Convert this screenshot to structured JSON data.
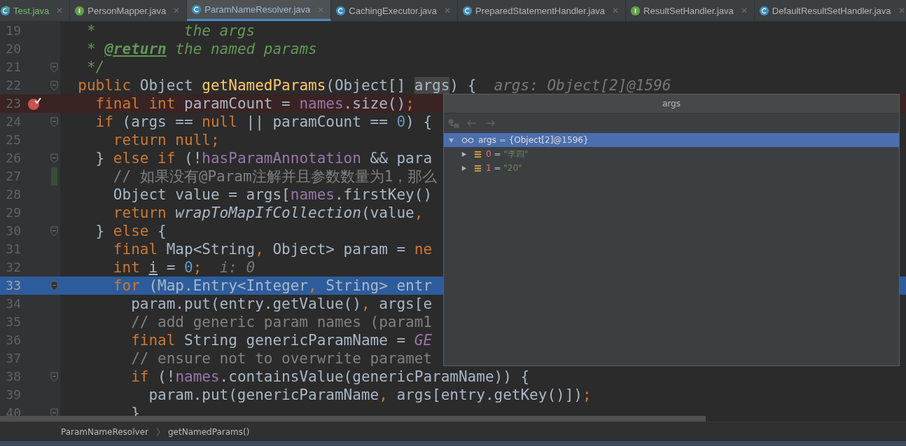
{
  "tabs": [
    {
      "label": "Test.java",
      "kind": "test",
      "selected": false
    },
    {
      "label": "PersonMapper.java",
      "kind": "interface",
      "selected": false
    },
    {
      "label": "ParamNameResolver.java",
      "kind": "class",
      "selected": true
    },
    {
      "label": "CachingExecutor.java",
      "kind": "class",
      "selected": false
    },
    {
      "label": "PreparedStatementHandler.java",
      "kind": "class",
      "selected": false
    },
    {
      "label": "ResultSetHandler.java",
      "kind": "interface",
      "selected": false
    },
    {
      "label": "DefaultResultSetHandler.java",
      "kind": "class",
      "selected": false
    }
  ],
  "editor": {
    "lines": [
      {
        "number": "19",
        "kind": "plain",
        "tokens": [
          {
            "kind": "doc",
            "t": "   *          the args"
          }
        ]
      },
      {
        "number": "20",
        "kind": "plain",
        "tokens": [
          {
            "kind": "doc",
            "t": "   * "
          },
          {
            "kind": "doctag",
            "t": "@return"
          },
          {
            "kind": "doc",
            "t": " the named params"
          }
        ]
      },
      {
        "number": "21",
        "kind": "fold",
        "tokens": [
          {
            "kind": "doc",
            "t": "   */"
          }
        ]
      },
      {
        "number": "22",
        "kind": "fold",
        "tokens": [
          {
            "kind": "kw",
            "t": "  public"
          },
          {
            "kind": "plain",
            "t": " Object "
          },
          {
            "kind": "decl",
            "t": "getNamedParams"
          },
          {
            "kind": "plain",
            "t": "(Object[] "
          },
          {
            "kind": "hl",
            "t": "args"
          },
          {
            "kind": "plain",
            "t": ") {"
          },
          {
            "kind": "hint",
            "t": "  args: Object[2]@1596"
          }
        ]
      },
      {
        "number": "23",
        "kind": "breakpoint",
        "tokens": [
          {
            "kind": "kw",
            "t": "    final int"
          },
          {
            "kind": "plain",
            "t": " paramCount = "
          },
          {
            "kind": "field",
            "t": "names"
          },
          {
            "kind": "plain",
            "t": ".size()"
          },
          {
            "kind": "kw",
            "t": ";"
          }
        ]
      },
      {
        "number": "24",
        "kind": "fold",
        "tokens": [
          {
            "kind": "kw",
            "t": "    if"
          },
          {
            "kind": "plain",
            "t": " (args == "
          },
          {
            "kind": "kw",
            "t": "null"
          },
          {
            "kind": "plain",
            "t": " || paramCount == "
          },
          {
            "kind": "num",
            "t": "0"
          },
          {
            "kind": "plain",
            "t": ") {"
          }
        ]
      },
      {
        "number": "25",
        "kind": "plain",
        "tokens": [
          {
            "kind": "kw",
            "t": "      return null;"
          }
        ]
      },
      {
        "number": "26",
        "kind": "fold",
        "tokens": [
          {
            "kind": "plain",
            "t": "    } "
          },
          {
            "kind": "kw",
            "t": "else if"
          },
          {
            "kind": "plain",
            "t": " (!"
          },
          {
            "kind": "field",
            "t": "hasParamAnnotation"
          },
          {
            "kind": "plain",
            "t": " && para"
          }
        ]
      },
      {
        "number": "27",
        "kind": "changed",
        "tokens": [
          {
            "kind": "comment",
            "t": "      // 如果没有@Param注解并且参数数量为1，那么"
          }
        ]
      },
      {
        "number": "28",
        "kind": "plain",
        "tokens": [
          {
            "kind": "plain",
            "t": "      Object value = args["
          },
          {
            "kind": "field",
            "t": "names"
          },
          {
            "kind": "plain",
            "t": ".firstKey()"
          }
        ]
      },
      {
        "number": "29",
        "kind": "plain",
        "tokens": [
          {
            "kind": "kw",
            "t": "      return"
          },
          {
            "kind": "ital",
            "t": " wrapToMapIfCollection"
          },
          {
            "kind": "plain",
            "t": "(value"
          },
          {
            "kind": "kw",
            "t": ","
          }
        ]
      },
      {
        "number": "30",
        "kind": "fold",
        "tokens": [
          {
            "kind": "plain",
            "t": "    } "
          },
          {
            "kind": "kw",
            "t": "else"
          },
          {
            "kind": "plain",
            "t": " {"
          }
        ]
      },
      {
        "number": "31",
        "kind": "plain",
        "tokens": [
          {
            "kind": "kw",
            "t": "      final"
          },
          {
            "kind": "plain",
            "t": " Map<String"
          },
          {
            "kind": "kw",
            "t": ","
          },
          {
            "kind": "plain",
            "t": " Object> param = "
          },
          {
            "kind": "kw",
            "t": "ne"
          }
        ]
      },
      {
        "number": "32",
        "kind": "plain",
        "tokens": [
          {
            "kind": "kw",
            "t": "      int "
          },
          {
            "kind": "uline",
            "t": "i"
          },
          {
            "kind": "plain",
            "t": " = "
          },
          {
            "kind": "num",
            "t": "0"
          },
          {
            "kind": "kw",
            "t": ";"
          },
          {
            "kind": "hint",
            "t": "  i: 0"
          }
        ]
      },
      {
        "number": "33",
        "kind": "execution",
        "tokens": [
          {
            "kind": "kw",
            "t": "      for"
          },
          {
            "kind": "plain",
            "t": " (Map.Entry<Integer"
          },
          {
            "kind": "kw",
            "t": ","
          },
          {
            "kind": "plain",
            "t": " String> entr"
          }
        ]
      },
      {
        "number": "34",
        "kind": "plain",
        "tokens": [
          {
            "kind": "plain",
            "t": "        param.put(entry.getValue()"
          },
          {
            "kind": "kw",
            "t": ","
          },
          {
            "kind": "plain",
            "t": " args[e"
          }
        ]
      },
      {
        "number": "35",
        "kind": "plain",
        "tokens": [
          {
            "kind": "comment",
            "t": "        // add generic param names (param1"
          }
        ]
      },
      {
        "number": "36",
        "kind": "plain",
        "tokens": [
          {
            "kind": "kw",
            "t": "        final"
          },
          {
            "kind": "plain",
            "t": " String genericParamName = "
          },
          {
            "kind": "const",
            "t": "GE"
          }
        ]
      },
      {
        "number": "37",
        "kind": "plain",
        "tokens": [
          {
            "kind": "comment",
            "t": "        // ensure not to overwrite paramet"
          }
        ]
      },
      {
        "number": "38",
        "kind": "fold",
        "tokens": [
          {
            "kind": "kw",
            "t": "        if"
          },
          {
            "kind": "plain",
            "t": " (!"
          },
          {
            "kind": "field",
            "t": "names"
          },
          {
            "kind": "plain",
            "t": ".containsValue(genericParamName)) {"
          }
        ]
      },
      {
        "number": "39",
        "kind": "plain",
        "tokens": [
          {
            "kind": "plain",
            "t": "          param.put(genericParamName"
          },
          {
            "kind": "kw",
            "t": ","
          },
          {
            "kind": "plain",
            "t": " args[entry.getKey()])"
          },
          {
            "kind": "kw",
            "t": ";"
          }
        ]
      },
      {
        "number": "40",
        "kind": "fold",
        "tokens": [
          {
            "kind": "plain",
            "t": "        }"
          }
        ]
      }
    ]
  },
  "popup": {
    "title": "args",
    "tree": [
      {
        "name": "args",
        "op": "=",
        "value": "{Object[2]@1596}",
        "kind": "object",
        "expanded": true,
        "selected": true,
        "children": [
          {
            "name": "0",
            "op": "=",
            "value": "\"李四\"",
            "kind": "element",
            "expanded": false,
            "selected": false
          },
          {
            "name": "1",
            "op": "=",
            "value": "\"20\"",
            "kind": "element",
            "expanded": false,
            "selected": false
          }
        ]
      }
    ]
  },
  "breadcrumbs": [
    "ParamNameResolver",
    "getNamedParams()"
  ]
}
